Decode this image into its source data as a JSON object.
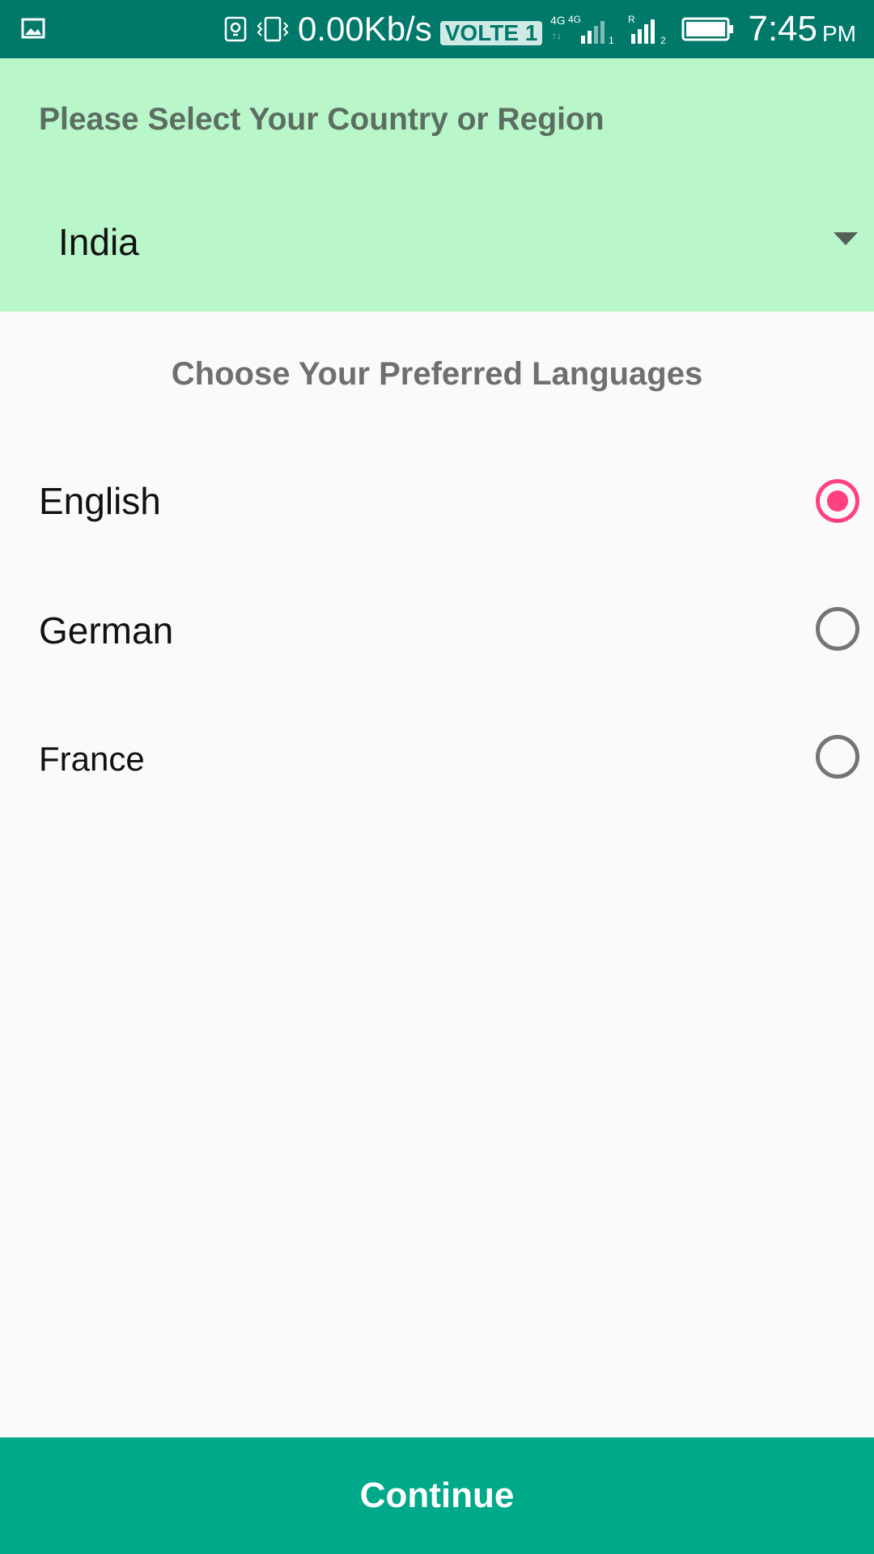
{
  "status_bar": {
    "network_speed": "0.00Kb/s",
    "volte_badge": "VOLTE 1",
    "time": "7:45",
    "ampm": "PM",
    "icons": [
      "gallery-icon",
      "lightbulb-icon",
      "vibrate-icon",
      "signal-4g-sim1-icon",
      "signal-sim2-icon",
      "battery-icon"
    ]
  },
  "country": {
    "title": "Please Select Your Country or Region",
    "selected": "India"
  },
  "languages": {
    "heading": "Choose Your Preferred Languages",
    "options": [
      {
        "label": "English",
        "selected": true
      },
      {
        "label": "German",
        "selected": false
      },
      {
        "label": "France",
        "selected": false
      }
    ]
  },
  "footer": {
    "continue_label": "Continue"
  },
  "colors": {
    "status_bar": "#00796b",
    "country_panel": "#b9f6ca",
    "accent_radio": "#ff4081",
    "continue_button": "#00a98a"
  }
}
